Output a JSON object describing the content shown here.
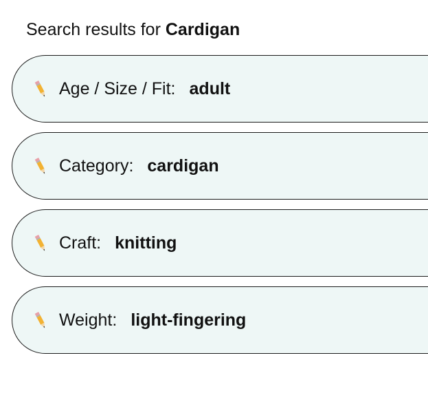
{
  "header": {
    "prefix": "Search results for",
    "query": "Cardigan"
  },
  "filters": [
    {
      "icon": "pencil-icon",
      "label": "Age / Size / Fit:",
      "value": "adult"
    },
    {
      "icon": "pencil-icon",
      "label": "Category:",
      "value": "cardigan"
    },
    {
      "icon": "pencil-icon",
      "label": "Craft:",
      "value": "knitting"
    },
    {
      "icon": "pencil-icon",
      "label": "Weight:",
      "value": "light-fingering"
    }
  ],
  "colors": {
    "pill_background": "#eef7f6",
    "pill_border": "#1a1a1a",
    "text": "#111111"
  }
}
